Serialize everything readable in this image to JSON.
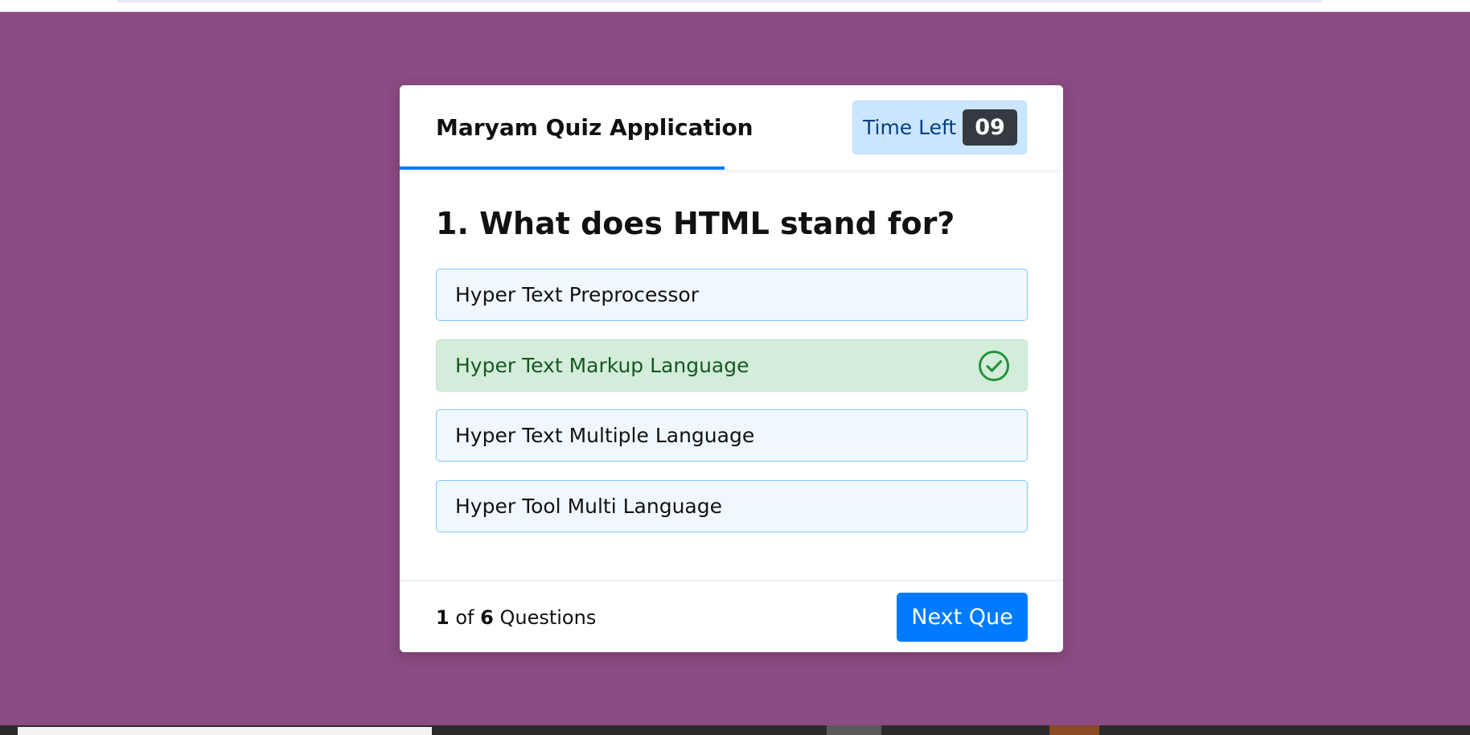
{
  "header": {
    "title": "Maryam Quiz Application",
    "timer_label": "Time Left",
    "timer_seconds": "09",
    "time_progress": 0.49
  },
  "question": {
    "text": "1. What does HTML stand for?"
  },
  "options": [
    {
      "label": "Hyper Text Preprocessor",
      "state": "default"
    },
    {
      "label": "Hyper Text Markup Language",
      "state": "correct"
    },
    {
      "label": "Hyper Text Multiple Language",
      "state": "default"
    },
    {
      "label": "Hyper Tool Multi Language",
      "state": "default"
    }
  ],
  "footer": {
    "current": "1",
    "of": "of",
    "total": "6",
    "questions_word": "Questions",
    "next_label": "Next Que"
  },
  "colors": {
    "background": "#8b4b83",
    "accent": "#007bff",
    "correct_bg": "#d4edda",
    "correct_text": "#155724",
    "timer_bg": "#cce5ff"
  },
  "icons": {
    "correct_option": "check-circle-icon"
  }
}
